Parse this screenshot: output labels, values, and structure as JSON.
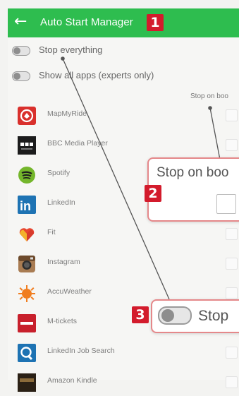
{
  "appbar": {
    "back_icon": "arrow-left-icon",
    "title": "Auto Start Manager",
    "color": "#2ebd4f"
  },
  "toggles": [
    {
      "label": "Stop everything",
      "on": false
    },
    {
      "label": "Show all apps (experts only)",
      "on": false
    }
  ],
  "column_header": "Stop on boo",
  "apps": [
    {
      "name": "MapMyRide",
      "icon": "mapmyride-icon",
      "checked": false
    },
    {
      "name": "BBC Media Player",
      "icon": "bbc-media-player-icon",
      "checked": false
    },
    {
      "name": "Spotify",
      "icon": "spotify-icon",
      "checked": false
    },
    {
      "name": "LinkedIn",
      "icon": "linkedin-icon",
      "checked": false
    },
    {
      "name": "Fit",
      "icon": "google-fit-icon",
      "checked": false
    },
    {
      "name": "Instagram",
      "icon": "instagram-icon",
      "checked": false
    },
    {
      "name": "AccuWeather",
      "icon": "accuweather-icon",
      "checked": false
    },
    {
      "name": "M-tickets",
      "icon": "m-tickets-icon",
      "checked": false
    },
    {
      "name": "LinkedIn Job Search",
      "icon": "linkedin-job-search-icon",
      "checked": false
    },
    {
      "name": "Amazon Kindle",
      "icon": "amazon-kindle-icon",
      "checked": false
    }
  ],
  "callouts": {
    "badge_1": "1",
    "badge_2": "2",
    "badge_3": "3",
    "callout_2_text": "Stop on boo",
    "callout_3_text": "Stop",
    "accent": "#d31b2c",
    "border": "#e5888a"
  }
}
